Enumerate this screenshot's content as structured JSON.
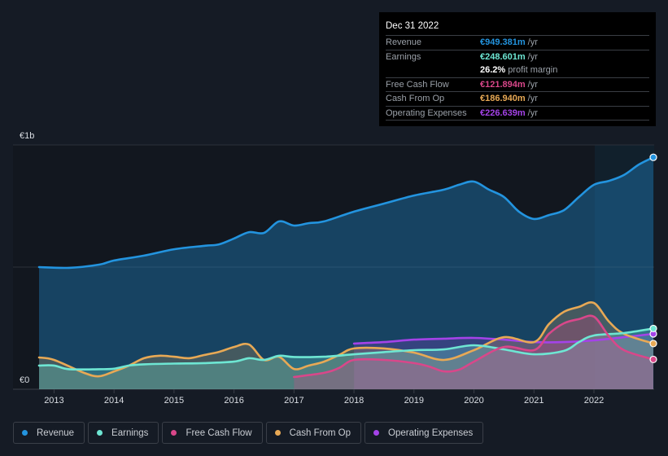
{
  "tooltip": {
    "date": "Dec 31 2022",
    "rows": [
      {
        "label": "Revenue",
        "value": "€949.381m",
        "unit": "/yr",
        "color": "#2394df"
      },
      {
        "label": "Earnings",
        "value": "€248.601m",
        "unit": "/yr",
        "color": "#6ee6d3"
      },
      {
        "label": "",
        "value": "26.2%",
        "unit": "profit margin",
        "color": "#ffffff"
      },
      {
        "label": "Free Cash Flow",
        "value": "€121.894m",
        "unit": "/yr",
        "color": "#d9478a"
      },
      {
        "label": "Cash From Op",
        "value": "€186.940m",
        "unit": "/yr",
        "color": "#e8a955"
      },
      {
        "label": "Operating Expenses",
        "value": "€226.639m",
        "unit": "/yr",
        "color": "#a443e8"
      }
    ]
  },
  "chart_data": {
    "type": "area",
    "title": "",
    "xlabel": "",
    "ylabel": "",
    "y_tick_labels": [
      "€0",
      "€1b"
    ],
    "ylim": [
      0,
      1000
    ],
    "y_unit": "€m",
    "xlim": [
      2012.75,
      2022.99
    ],
    "x_ticks": [
      2013,
      2014,
      2015,
      2016,
      2017,
      2018,
      2019,
      2020,
      2021,
      2022
    ],
    "x_tick_labels": [
      "2013",
      "2014",
      "2015",
      "2016",
      "2017",
      "2018",
      "2019",
      "2020",
      "2021",
      "2022"
    ],
    "gridlines": [
      0,
      500,
      1000
    ],
    "highlight_from": 2022.0,
    "legend_position": "bottom-left",
    "series": [
      {
        "name": "Revenue",
        "color": "#2394df",
        "x": [
          2012.75,
          2013.25,
          2013.75,
          2014.0,
          2014.5,
          2015.0,
          2015.5,
          2015.75,
          2016.0,
          2016.25,
          2016.5,
          2016.75,
          2017.0,
          2017.25,
          2017.5,
          2018.0,
          2018.5,
          2019.0,
          2019.5,
          2019.75,
          2020.0,
          2020.25,
          2020.5,
          2020.75,
          2021.0,
          2021.25,
          2021.5,
          2021.75,
          2022.0,
          2022.25,
          2022.5,
          2022.75,
          2022.99
        ],
        "values": [
          500,
          497,
          510,
          527,
          547,
          573,
          587,
          593,
          617,
          643,
          640,
          687,
          670,
          680,
          687,
          727,
          760,
          793,
          817,
          837,
          850,
          817,
          787,
          727,
          697,
          713,
          733,
          787,
          837,
          853,
          877,
          920,
          949.381
        ]
      },
      {
        "name": "Earnings",
        "color": "#6ee6d3",
        "x": [
          2012.75,
          2013.0,
          2013.25,
          2013.75,
          2014.0,
          2014.25,
          2014.5,
          2015.0,
          2015.5,
          2016.0,
          2016.25,
          2016.5,
          2016.75,
          2017.0,
          2017.5,
          2018.0,
          2018.5,
          2019.0,
          2019.5,
          2020.0,
          2020.5,
          2021.0,
          2021.5,
          2021.75,
          2022.0,
          2022.5,
          2022.99
        ],
        "values": [
          97,
          97,
          82,
          82,
          84,
          97,
          102,
          105,
          107,
          113,
          127,
          120,
          137,
          132,
          133,
          143,
          152,
          160,
          163,
          180,
          163,
          143,
          157,
          193,
          220,
          230,
          248.601
        ]
      },
      {
        "name": "Free Cash Flow",
        "color": "#d9478a",
        "x": [
          2017.0,
          2017.5,
          2017.75,
          2018.0,
          2018.5,
          2019.0,
          2019.25,
          2019.5,
          2019.75,
          2020.0,
          2020.5,
          2021.0,
          2021.25,
          2021.5,
          2021.75,
          2022.0,
          2022.25,
          2022.5,
          2022.99
        ],
        "values": [
          50,
          67,
          87,
          120,
          120,
          107,
          93,
          73,
          80,
          113,
          173,
          160,
          227,
          270,
          287,
          297,
          217,
          160,
          121.894
        ]
      },
      {
        "name": "Cash From Op",
        "color": "#e8a955",
        "x": [
          2012.75,
          2013.0,
          2013.5,
          2013.75,
          2014.0,
          2014.25,
          2014.5,
          2014.75,
          2015.0,
          2015.25,
          2015.5,
          2015.75,
          2016.0,
          2016.25,
          2016.5,
          2016.75,
          2017.0,
          2017.25,
          2017.5,
          2017.75,
          2018.0,
          2018.5,
          2019.0,
          2019.5,
          2020.0,
          2020.5,
          2021.0,
          2021.25,
          2021.5,
          2021.75,
          2022.0,
          2022.25,
          2022.5,
          2022.99
        ],
        "values": [
          130,
          120,
          67,
          53,
          73,
          97,
          127,
          137,
          133,
          127,
          140,
          153,
          173,
          183,
          120,
          133,
          83,
          97,
          113,
          140,
          167,
          167,
          150,
          120,
          160,
          213,
          193,
          267,
          317,
          337,
          353,
          277,
          227,
          186.94
        ]
      },
      {
        "name": "Operating Expenses",
        "color": "#a443e8",
        "x": [
          2018.0,
          2018.5,
          2019.0,
          2019.5,
          2020.0,
          2020.5,
          2021.0,
          2021.5,
          2022.0,
          2022.5,
          2022.99
        ],
        "values": [
          187,
          193,
          203,
          207,
          210,
          203,
          193,
          193,
          200,
          213,
          226.639
        ]
      }
    ]
  },
  "legend": [
    {
      "label": "Revenue",
      "color": "#2394df"
    },
    {
      "label": "Earnings",
      "color": "#6ee6d3"
    },
    {
      "label": "Free Cash Flow",
      "color": "#d9478a"
    },
    {
      "label": "Cash From Op",
      "color": "#e8a955"
    },
    {
      "label": "Operating Expenses",
      "color": "#a443e8"
    }
  ]
}
